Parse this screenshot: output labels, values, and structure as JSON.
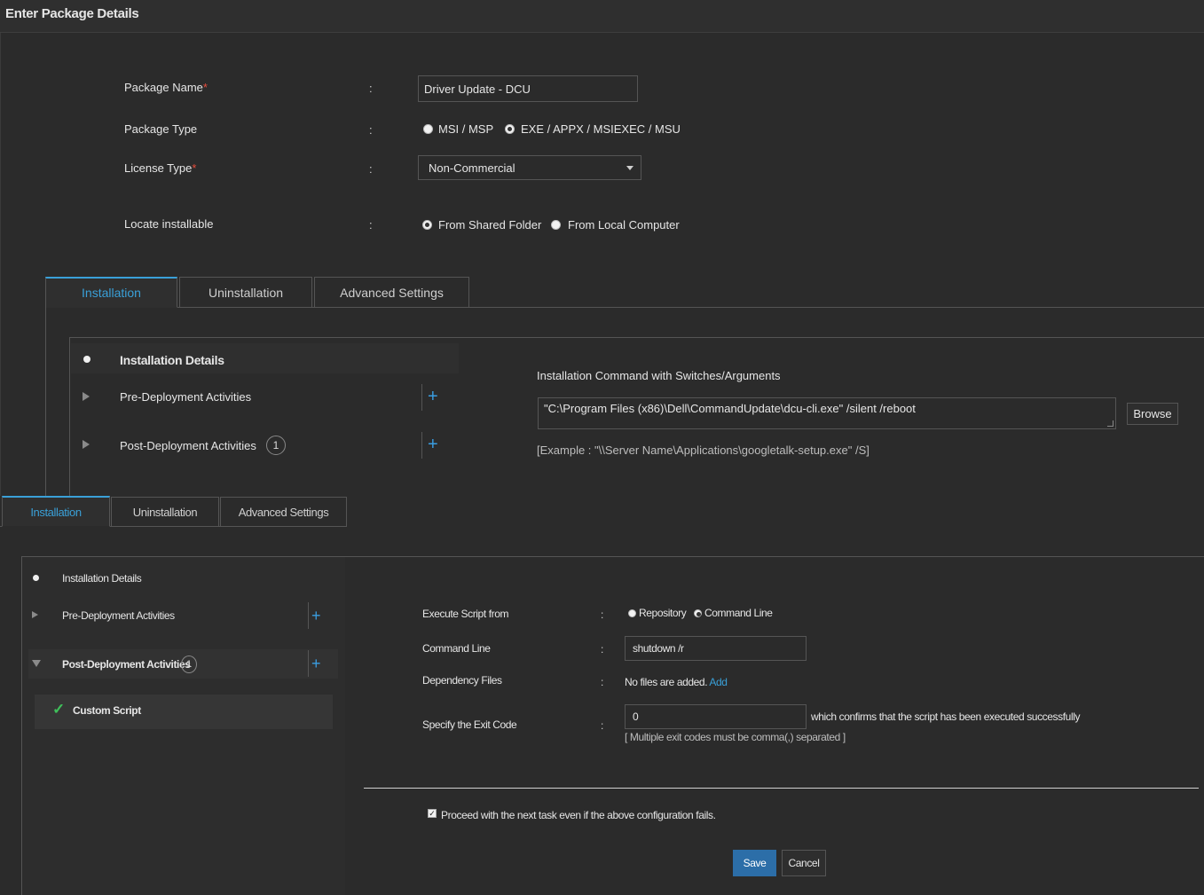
{
  "page_title": "Enter Package Details",
  "form": {
    "package_name": {
      "label": "Package Name",
      "required": "*",
      "value": "Driver Update - DCU"
    },
    "package_type": {
      "label": "Package Type",
      "options": [
        "MSI / MSP",
        "EXE / APPX / MSIEXEC / MSU"
      ],
      "selected": "EXE / APPX / MSIEXEC / MSU"
    },
    "license_type": {
      "label": "License Type",
      "required": "*",
      "value": "Non-Commercial"
    },
    "locate_installable": {
      "label": "Locate installable",
      "options": [
        "From Shared Folder",
        "From Local Computer"
      ],
      "selected": "From Shared Folder"
    },
    "colon": ":"
  },
  "upper_tabs": [
    "Installation",
    "Uninstallation",
    "Advanced Settings"
  ],
  "upper_tree": {
    "details": "Installation Details",
    "pre": "Pre-Deployment Activities",
    "post": "Post-Deployment Activities",
    "post_count": "1"
  },
  "install_cmd": {
    "label": "Installation Command with Switches/Arguments",
    "value": "\"C:\\Program Files (x86)\\Dell\\CommandUpdate\\dcu-cli.exe\" /silent /reboot",
    "browse": "Browse",
    "example": "[Example : \"\\\\Server Name\\Applications\\googletalk-setup.exe\" /S]"
  },
  "lower_tabs": [
    "Installation",
    "Uninstallation",
    "Advanced Settings"
  ],
  "lower_tree": {
    "details": "Installation Details",
    "pre": "Pre-Deployment Activities",
    "post": "Post-Deployment Activities",
    "post_count": "1",
    "custom_script": "Custom Script"
  },
  "script": {
    "execute_from_label": "Execute Script from",
    "options": [
      "Repository",
      "Command Line"
    ],
    "selected": "Command Line",
    "command_line_label": "Command Line",
    "command_line_value": "shutdown /r",
    "dependency_label": "Dependency Files",
    "dependency_text": "No files are added.",
    "dependency_add": "Add",
    "exit_code_label": "Specify the Exit Code",
    "exit_code_value": "0",
    "exit_code_suffix": "which confirms that the script has been executed successfully",
    "exit_code_hint": "[ Multiple exit codes must be comma(,) separated ]",
    "proceed_text": "Proceed with the next task even if the above configuration fails.",
    "proceed_checked": true,
    "save": "Save",
    "cancel": "Cancel"
  },
  "colors": {
    "accent": "#3aa0d8",
    "primary_button": "#2c6ea8",
    "required": "#e74c3c",
    "background": "#2b2b2b"
  }
}
